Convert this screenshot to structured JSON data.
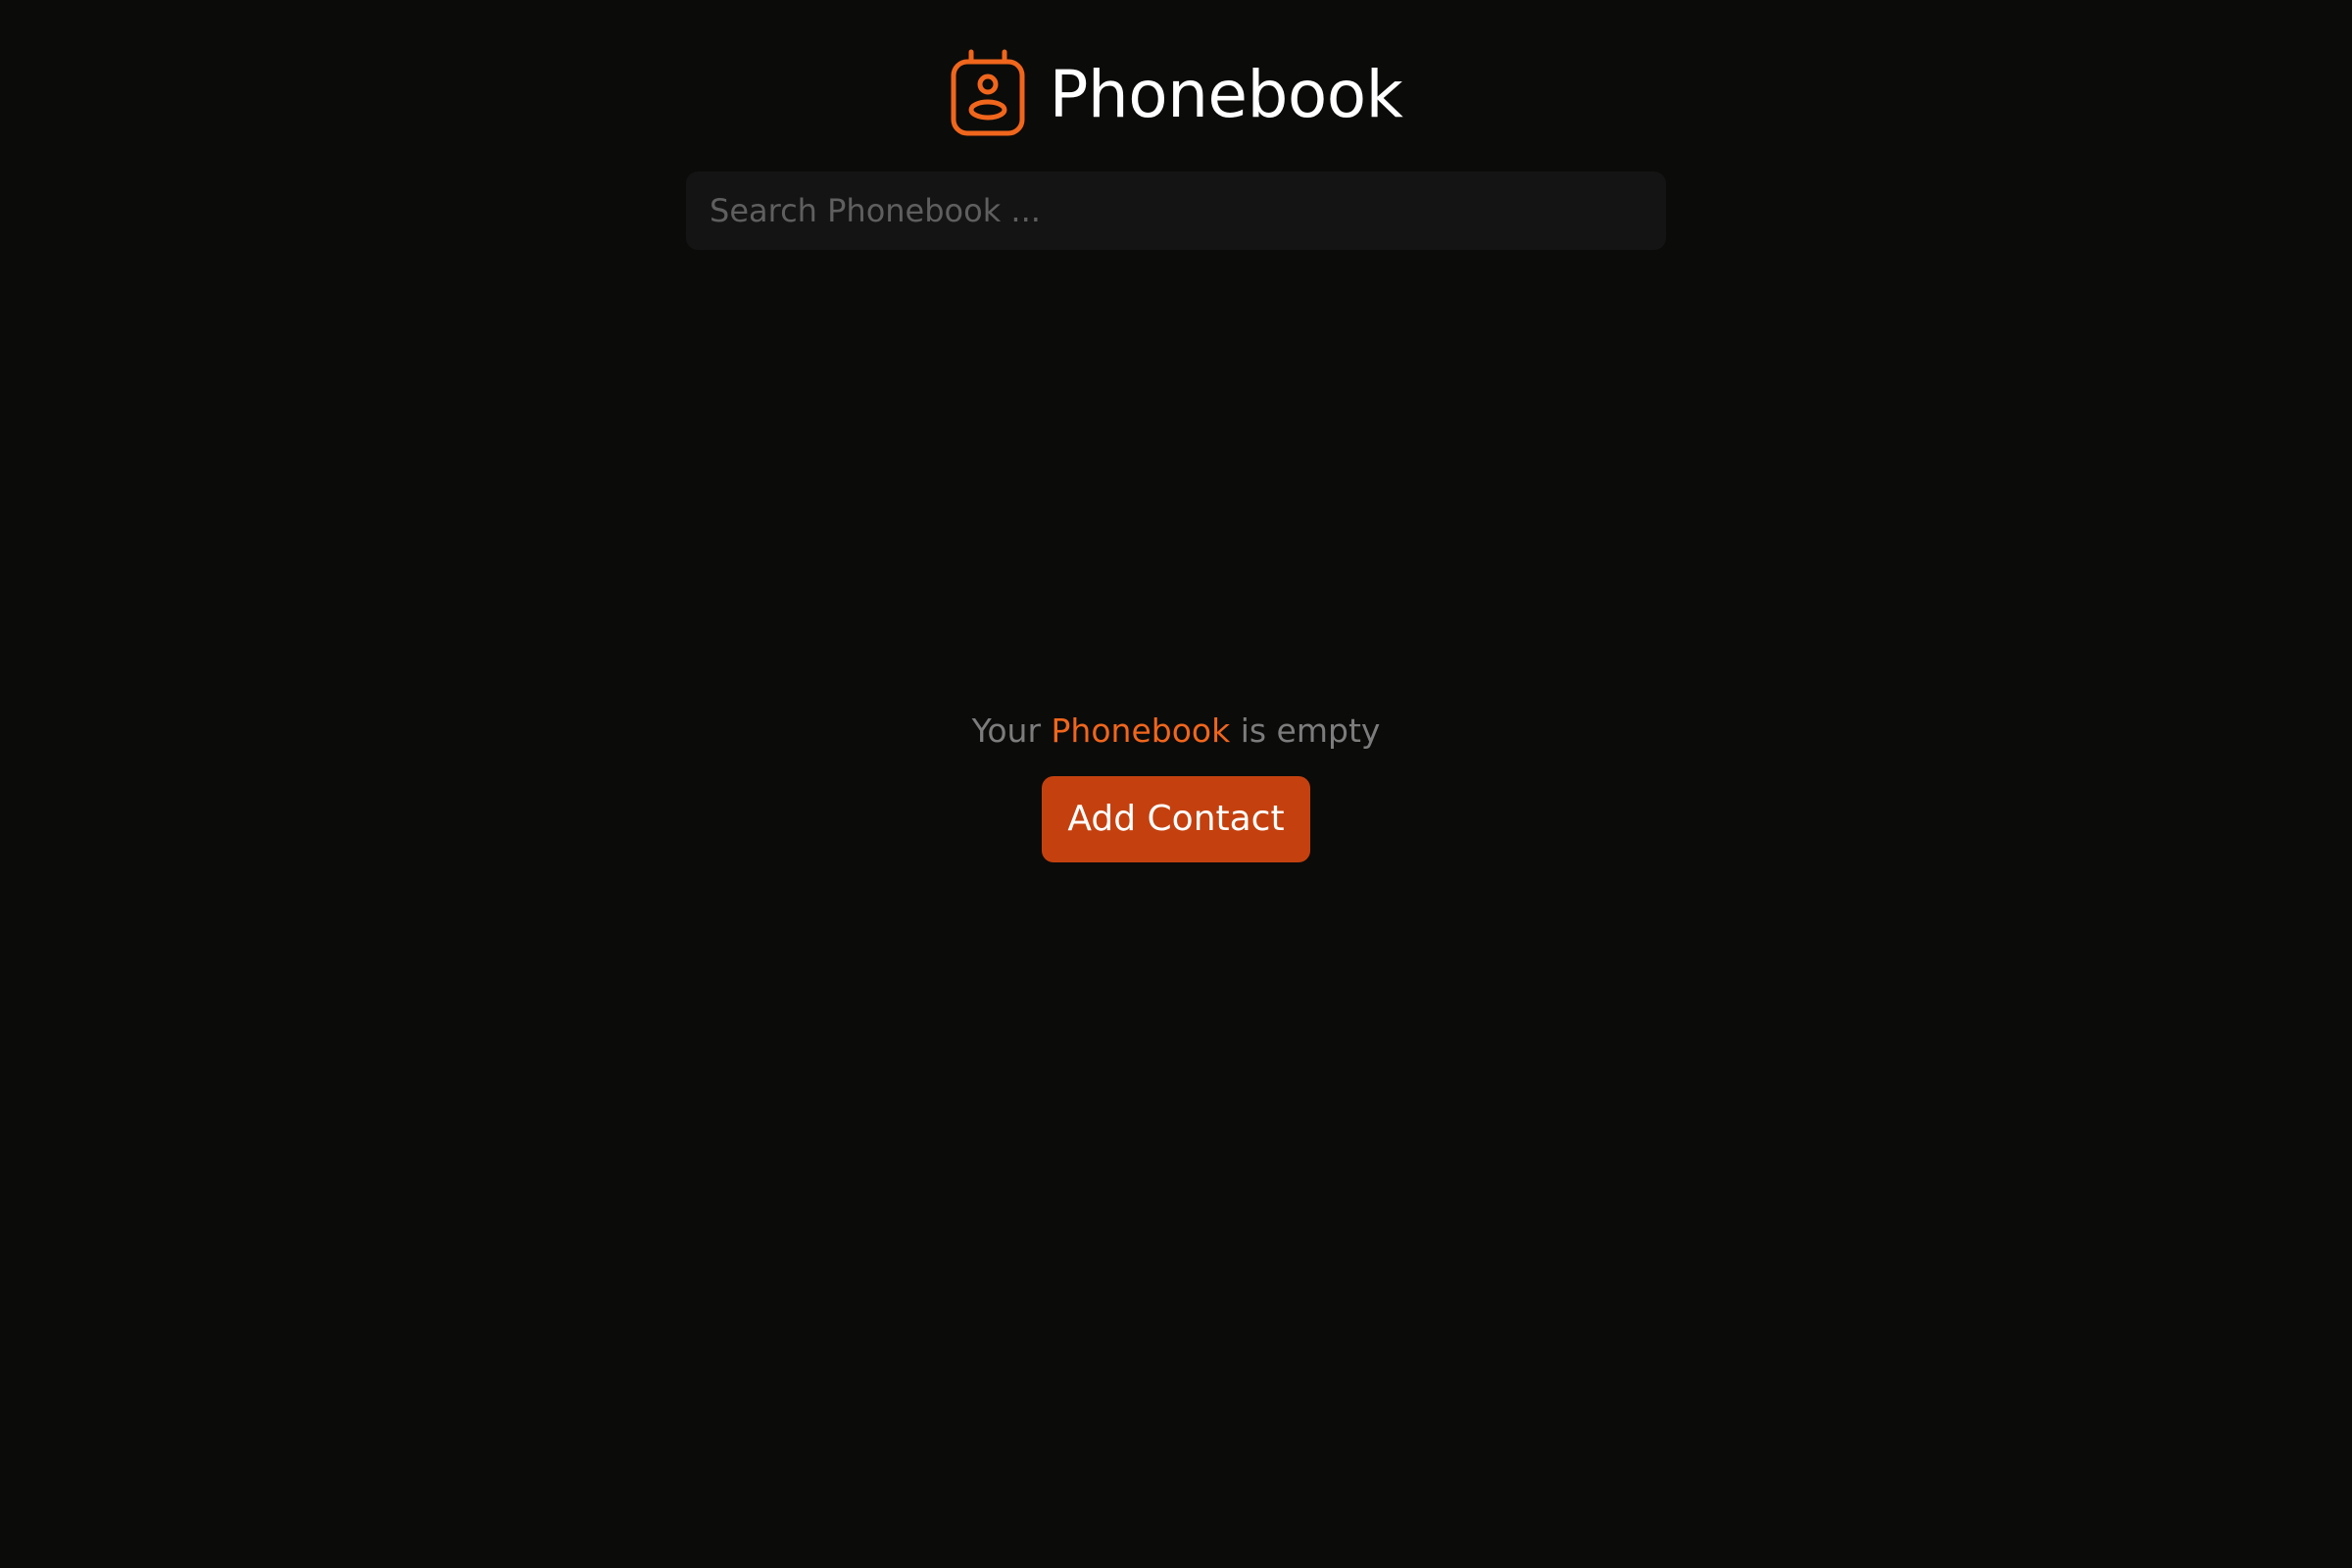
{
  "app": {
    "title": "Phonebook",
    "logo_icon": "contact-badge-icon",
    "accent_color": "#f0661c"
  },
  "search": {
    "placeholder": "Search Phonebook ...",
    "value": ""
  },
  "empty_state": {
    "prefix": "Your",
    "brand": "Phonebook",
    "suffix": "is empty",
    "add_button_label": "Add Contact",
    "button_color": "#c4410f"
  },
  "colors": {
    "background": "#0b0b0a",
    "search_background": "#141414"
  }
}
